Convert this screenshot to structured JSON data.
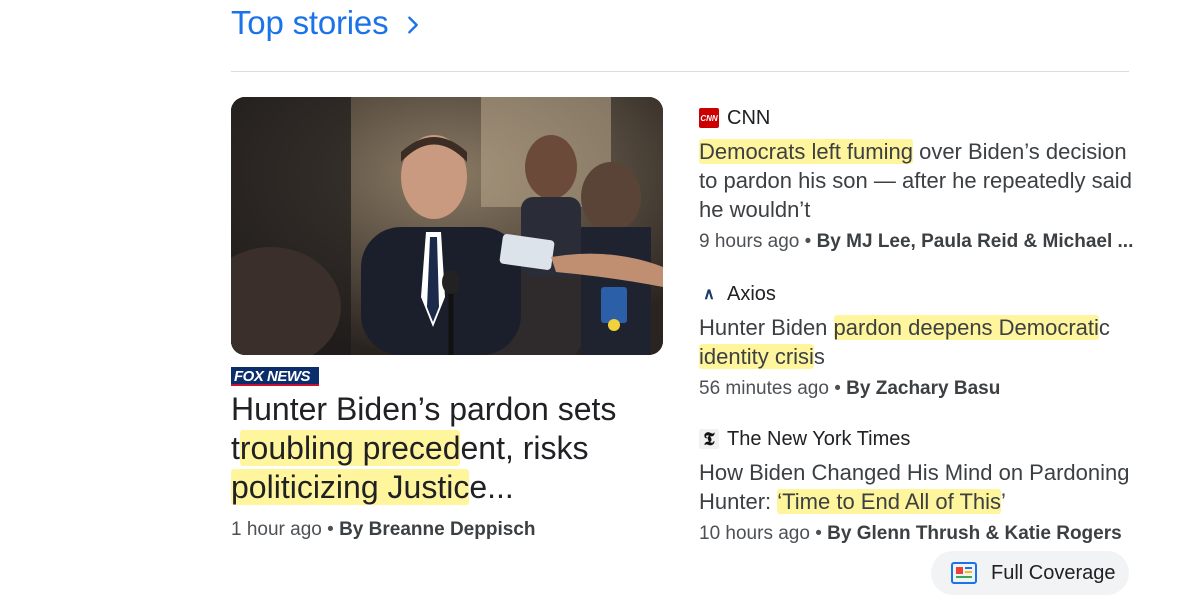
{
  "section": {
    "title": "Top stories"
  },
  "featured": {
    "source_logo": "FOX NEWS",
    "headline_parts": [
      "Hunter Biden’s pardon sets t",
      "roubling preced",
      "ent, risks ",
      "politicizing Justic",
      "e..."
    ],
    "time": "1 hour ago",
    "separator": " • ",
    "byline": "By Breanne Deppisch"
  },
  "stories": [
    {
      "source": "CNN",
      "headline_parts": [
        "Democrats left fuming",
        " over Biden’s decision to pardon his son — after he repeatedly said he wouldn’t"
      ],
      "time": "9 hours ago",
      "byline": "By MJ Lee, Paula Reid & Michael ..."
    },
    {
      "source": "Axios",
      "headline_parts": [
        "Hunter Biden ",
        "pardon deepens Democrati",
        "c ",
        "identity crisi",
        "s"
      ],
      "time": "56 minutes ago",
      "byline": "By Zachary Basu"
    },
    {
      "source": "The New York Times",
      "headline_parts": [
        "How Biden Changed His Mind on Pardoning Hunter: ",
        "‘Time to End All of This",
        "’"
      ],
      "time": "10 hours ago",
      "byline": "By Glenn Thrush & Katie Rogers"
    }
  ],
  "full_coverage": {
    "label": "Full Coverage"
  },
  "icons": {
    "chevron": "chevron-right-icon",
    "cnn": "cnn-logo-icon",
    "axios": "axios-logo-icon",
    "nyt": "nyt-logo-icon",
    "full_coverage": "full-coverage-icon"
  },
  "colors": {
    "link_blue": "#1a73e8",
    "highlight": "#fff59d",
    "fox_navy": "#0b2d6b",
    "cnn_red": "#cc0000"
  }
}
